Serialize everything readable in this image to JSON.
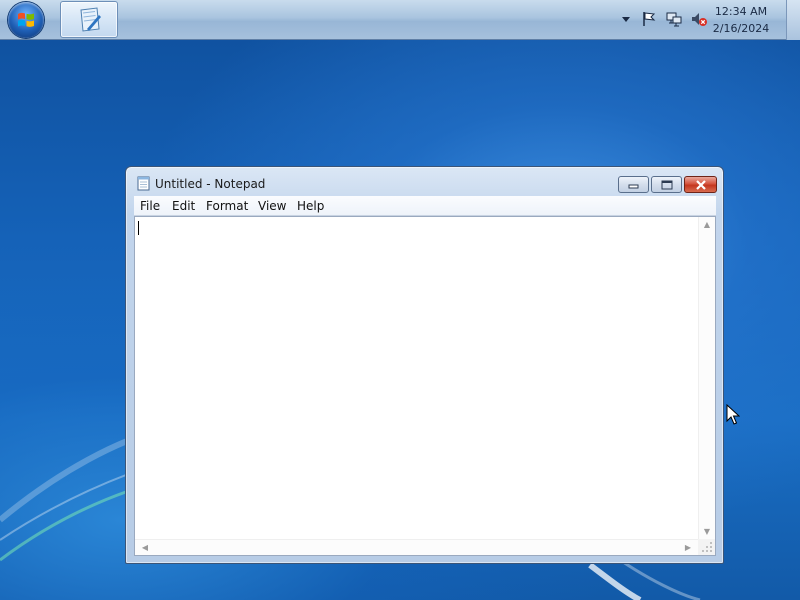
{
  "taskbar": {
    "start_button_icon": "windows-logo-icon",
    "pinned_apps": [
      {
        "name": "notepad",
        "icon": "notepad-icon",
        "active": true
      }
    ],
    "tray": {
      "icons": [
        "show-hidden-icons-icon",
        "action-center-flag-icon",
        "network-icon",
        "volume-muted-icon"
      ],
      "time": "12:34 AM",
      "date": "2/16/2024"
    }
  },
  "window": {
    "title": "Untitled - Notepad",
    "icon": "notepad-icon",
    "menu": [
      "File",
      "Edit",
      "Format",
      "View",
      "Help"
    ],
    "content": ""
  },
  "colors": {
    "desktop_blue": "#1562b8",
    "close_button_red": "#c4371f",
    "taskbar": "#a9c4df"
  }
}
